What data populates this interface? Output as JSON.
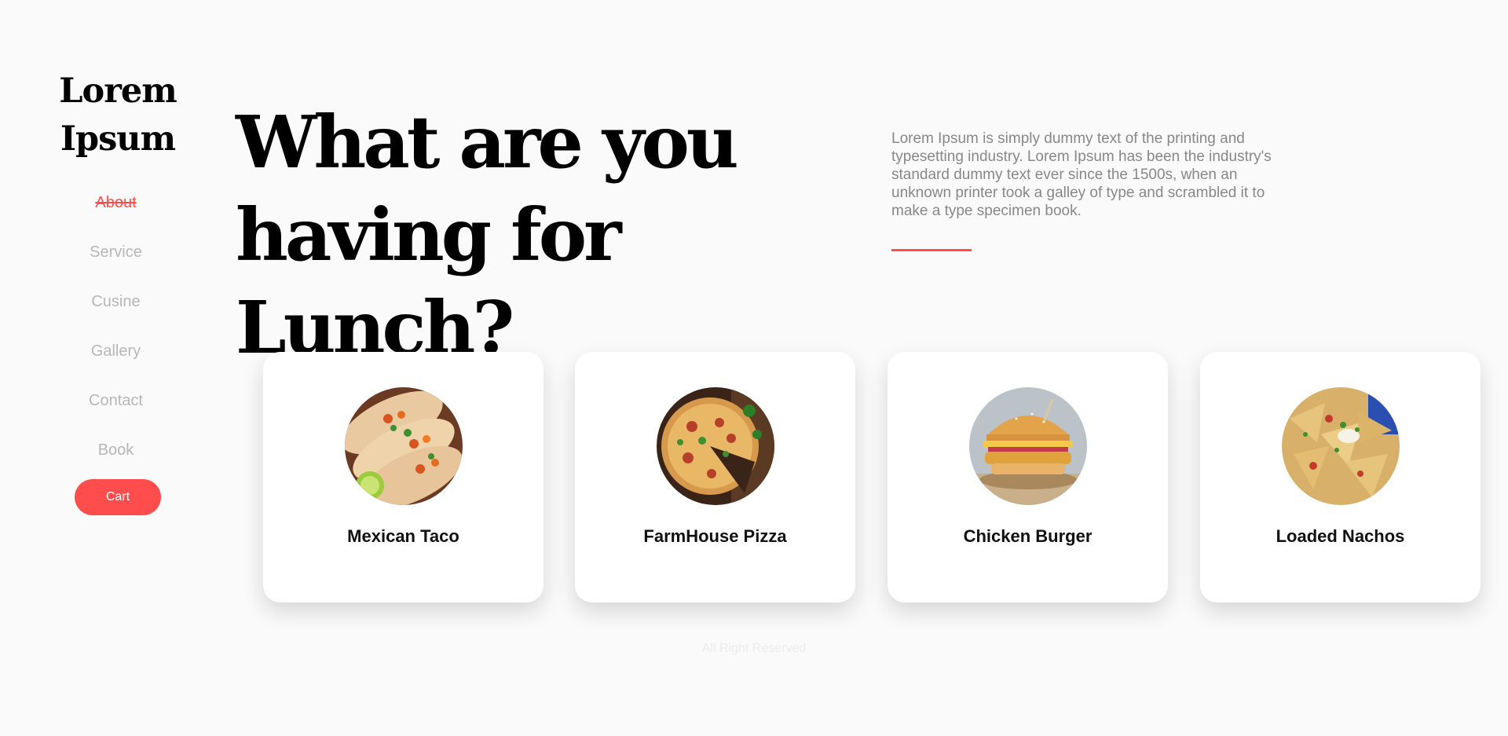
{
  "brand": {
    "logo_line1": "Lorem",
    "logo_line2": "Ipsum"
  },
  "nav": {
    "items": [
      {
        "label": "About"
      },
      {
        "label": "Service"
      },
      {
        "label": "Cusine"
      },
      {
        "label": "Gallery"
      },
      {
        "label": "Contact"
      },
      {
        "label": "Book"
      }
    ],
    "active_item": "About",
    "cart_label": "Cart"
  },
  "hero": {
    "title_line1": "What are you",
    "title_line2": "having for Lunch?",
    "description": "Lorem Ipsum is simply dummy text of the printing and typesetting industry. Lorem Ipsum has been the industry's standard dummy text ever since the 1500s, when an unknown printer took a galley of type and scrambled it to make a type specimen book."
  },
  "dishes": [
    {
      "name": "Mexican Taco",
      "icon": "taco-image"
    },
    {
      "name": "FarmHouse Pizza",
      "icon": "pizza-image"
    },
    {
      "name": "Chicken Burger",
      "icon": "burger-image"
    },
    {
      "name": "Loaded Nachos",
      "icon": "nachos-image"
    }
  ],
  "footer": {
    "text": "All Right Reserved"
  },
  "colors": {
    "accent": "#ff4d4d",
    "background": "#fafafa",
    "nav_text": "#b7b7b7",
    "body_text": "#888888"
  }
}
